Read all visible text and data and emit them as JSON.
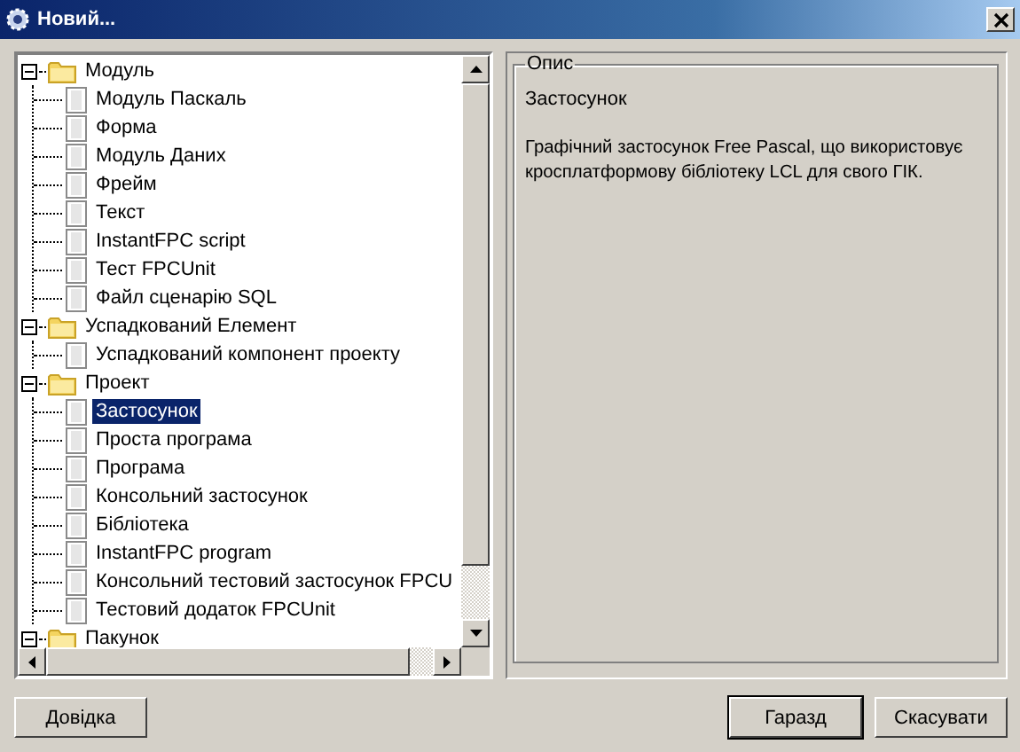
{
  "window": {
    "title": "Новий..."
  },
  "tree": [
    {
      "label": "Модуль",
      "expanded": true,
      "selected": false,
      "children": [
        {
          "label": "Модуль Паскаль",
          "selected": false
        },
        {
          "label": "Форма",
          "selected": false
        },
        {
          "label": "Модуль Даних",
          "selected": false
        },
        {
          "label": "Фрейм",
          "selected": false
        },
        {
          "label": "Текст",
          "selected": false
        },
        {
          "label": "InstantFPC script",
          "selected": false
        },
        {
          "label": "Тест FPCUnit",
          "selected": false
        },
        {
          "label": "Файл сценарію SQL",
          "selected": false
        }
      ]
    },
    {
      "label": "Успадкований Елемент",
      "expanded": true,
      "selected": false,
      "children": [
        {
          "label": "Успадкований компонент проекту",
          "selected": false
        }
      ]
    },
    {
      "label": "Проект",
      "expanded": true,
      "selected": false,
      "children": [
        {
          "label": "Застосунок",
          "selected": true
        },
        {
          "label": "Проста програма",
          "selected": false
        },
        {
          "label": "Програма",
          "selected": false
        },
        {
          "label": "Консольний застосунок",
          "selected": false
        },
        {
          "label": "Бібліотека",
          "selected": false
        },
        {
          "label": "InstantFPC program",
          "selected": false
        },
        {
          "label": "Консольний тестовий застосунок FPCU",
          "selected": false
        },
        {
          "label": "Тестовий додаток FPCUnit",
          "selected": false
        }
      ]
    },
    {
      "label": "Пакунок",
      "expanded": true,
      "selected": false
    }
  ],
  "description": {
    "legend": "Опис",
    "title": "Застосунок",
    "text": "Графічний застосунок Free Pascal, що використовує кросплатформову бібліотеку LCL для свого ГІК."
  },
  "buttons": {
    "help": "Довідка",
    "ok": "Гаразд",
    "cancel": "Скасувати"
  }
}
